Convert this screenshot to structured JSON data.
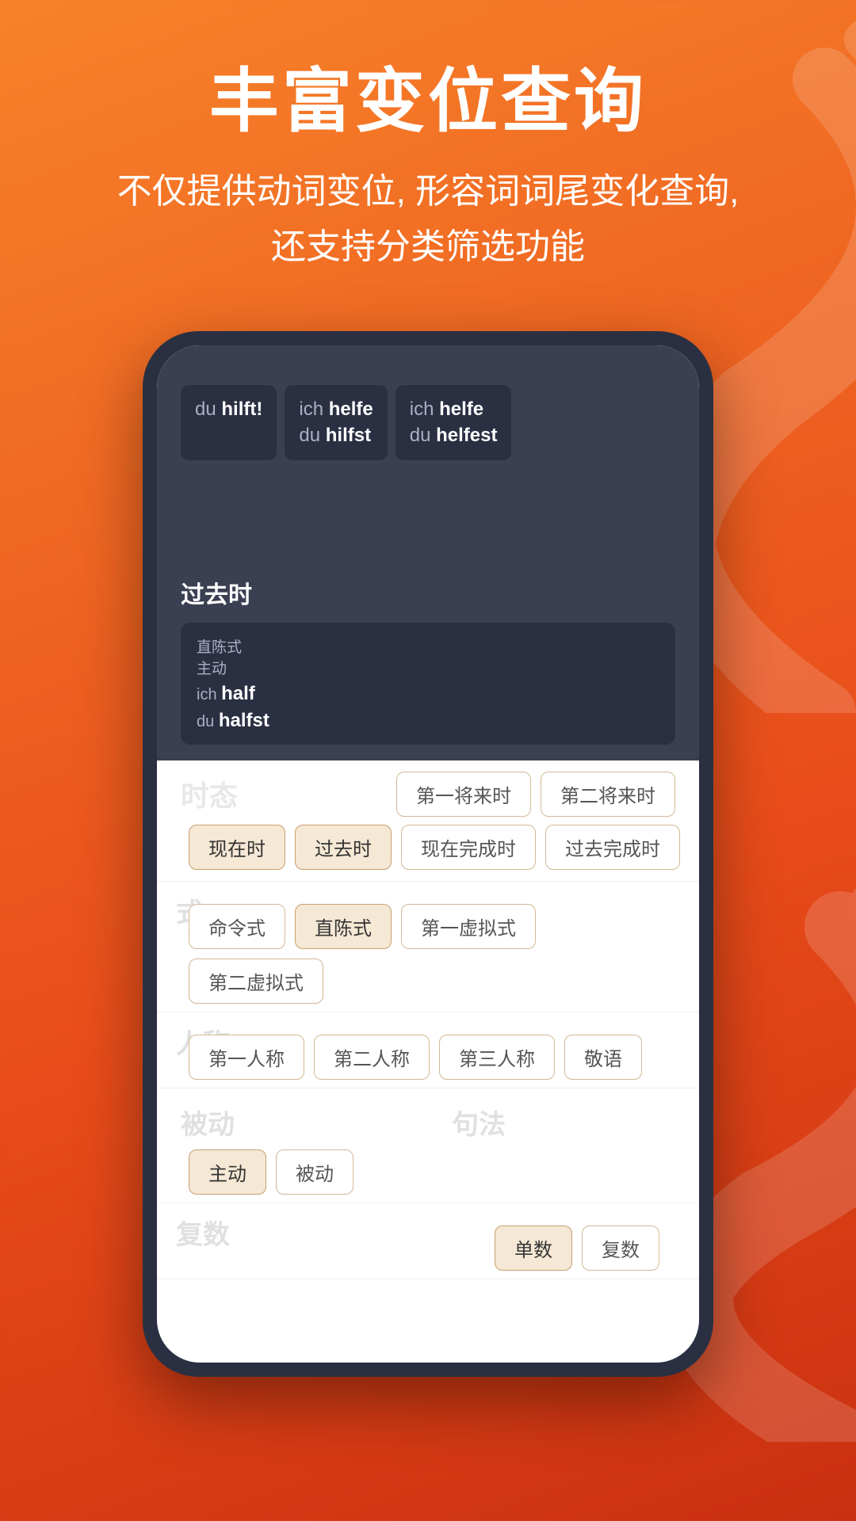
{
  "header": {
    "main_title": "丰富变位查询",
    "subtitle_line1": "不仅提供动词变位, 形容词词尾变化查询,",
    "subtitle_line2": "还支持分类筛选功能"
  },
  "phone": {
    "tooltips": [
      {
        "pronoun": "du",
        "verb": "hilft!"
      },
      {
        "pronoun": "ich",
        "verb": "helfe",
        "pronoun2": "du",
        "verb2": "hilfst"
      },
      {
        "pronoun": "ich",
        "verb": "helfe",
        "pronoun2": "du",
        "verb2": "helfest"
      }
    ],
    "dark_section": {
      "title": "过去时",
      "card": {
        "line1": "直陈式",
        "line2": "主动",
        "line3_pronoun": "ich",
        "line3_verb": "half",
        "line4_pronoun": "du",
        "line4_verb": "halfst"
      }
    },
    "filters": {
      "tense": {
        "label": "时态",
        "row1": [
          "第一将来时",
          "第二将来时"
        ],
        "row2": [
          "现在时",
          "过去时",
          "现在完成时",
          "过去完成时"
        ]
      },
      "mode": {
        "label": "式",
        "chips": [
          "命令式",
          "直陈式",
          "第一虚拟式",
          "第二虚拟式"
        ]
      },
      "person": {
        "label": "人称",
        "chips": [
          "第一人称",
          "第二人称",
          "第三人称",
          "敬语"
        ]
      },
      "voice": {
        "label": "被动",
        "chips": [
          "主动",
          "被动"
        ]
      },
      "syntax": {
        "label": "句法",
        "chips": []
      },
      "number": {
        "label": "复数",
        "chips": [
          "单数",
          "复数"
        ]
      }
    }
  }
}
